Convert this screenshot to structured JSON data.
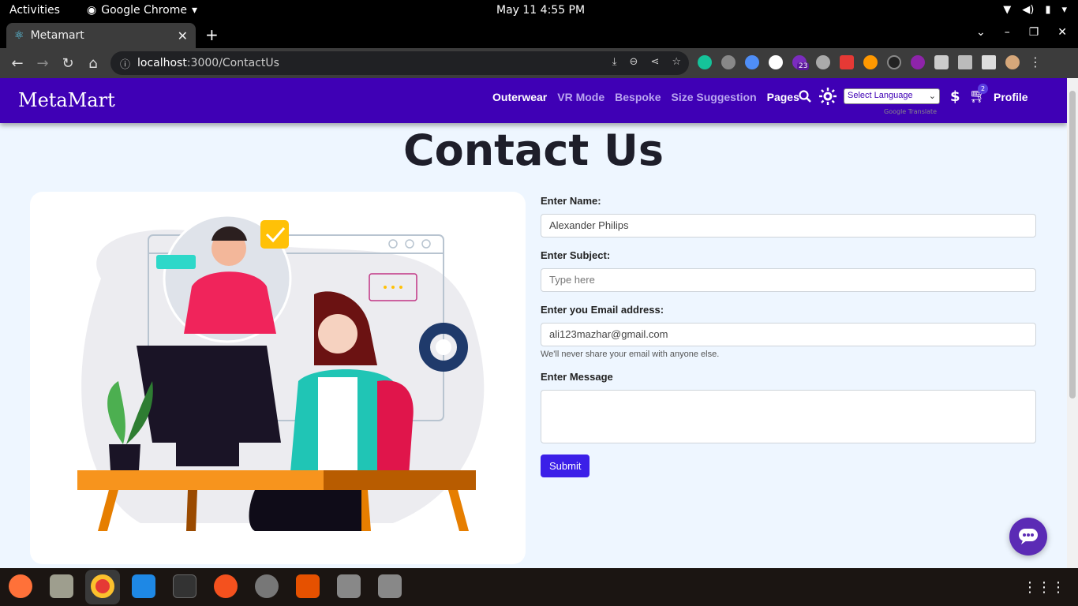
{
  "system": {
    "activities": "Activities",
    "app_name": "Google Chrome",
    "clock": "May 11  4:55 PM"
  },
  "browser": {
    "tab_title": "Metamart",
    "url_host": "localhost",
    "url_path": ":3000/ContactUs",
    "ext_badge": "23"
  },
  "navbar": {
    "brand": "MetaMart",
    "items": [
      {
        "label": "Outerwear",
        "active": true
      },
      {
        "label": "VR Mode",
        "active": false
      },
      {
        "label": "Bespoke",
        "active": false
      },
      {
        "label": "Size Suggestion",
        "active": false
      },
      {
        "label": "Pages",
        "active": true
      }
    ],
    "language_select": "Select Language",
    "translate_credit": "Google Translate",
    "currency_symbol": "$",
    "cart_count": "2",
    "profile": "Profile"
  },
  "page": {
    "title": "Contact Us"
  },
  "form": {
    "name_label": "Enter Name:",
    "name_value": "Alexander Philips",
    "subject_label": "Enter Subject:",
    "subject_placeholder": "Type here",
    "email_label": "Enter you Email address:",
    "email_value": "ali123mazhar@gmail.com",
    "email_help": "We'll never share your email with anyone else.",
    "message_label": "Enter Message",
    "message_value": "",
    "submit": "Submit"
  },
  "colors": {
    "navbar_bg": "#3f00b5",
    "page_bg": "#eef6ff",
    "button_bg": "#3b1fe8",
    "chat_fab": "#5b2bb5"
  }
}
